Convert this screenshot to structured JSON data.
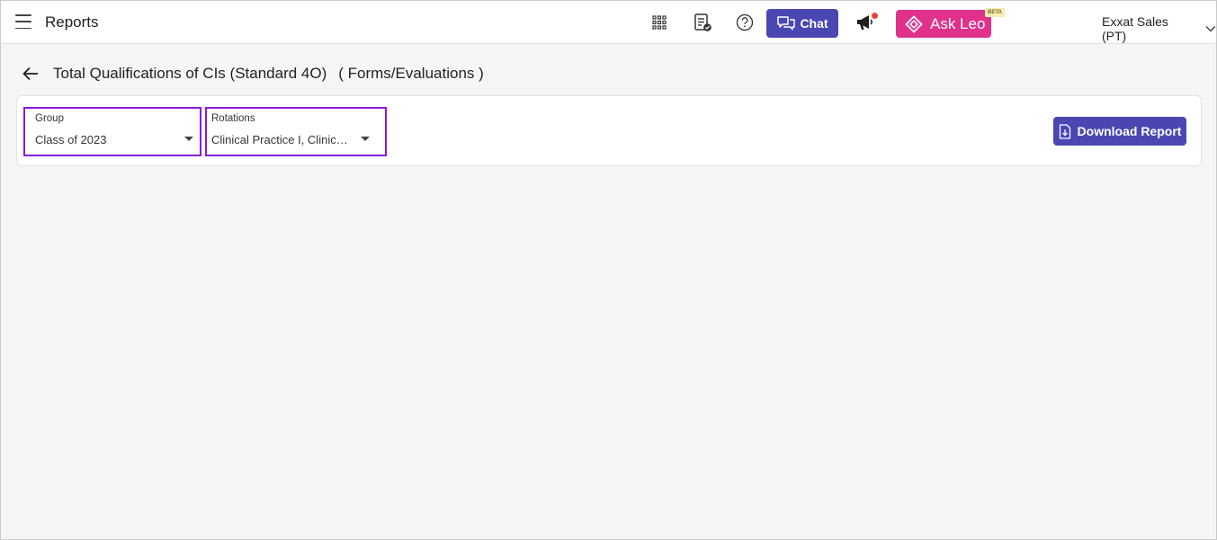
{
  "topbar": {
    "app_title": "Reports",
    "chat_label": "Chat",
    "askleo_label": "Ask Leo",
    "beta_label": "BETA",
    "user_name": "Exxat Sales (PT)",
    "icons": [
      "menu-icon",
      "apps-grid-icon",
      "checklist-icon",
      "help-icon",
      "chat-icon",
      "megaphone-icon",
      "leo-icon",
      "chevron-down-icon"
    ],
    "colors": {
      "primary": "#4a47b3",
      "askleo": "#e0318b",
      "notification": "#e8443a",
      "highlight": "#8a18d8"
    }
  },
  "page": {
    "title": "Total Qualifications of CIs (Standard 4O)",
    "subtitle": "( Forms/Evaluations )"
  },
  "filters": {
    "group": {
      "label": "Group",
      "value": "Class of 2023"
    },
    "rotations": {
      "label": "Rotations",
      "value": "Clinical Practice I, Clinic…"
    }
  },
  "actions": {
    "download_label": "Download Report"
  }
}
